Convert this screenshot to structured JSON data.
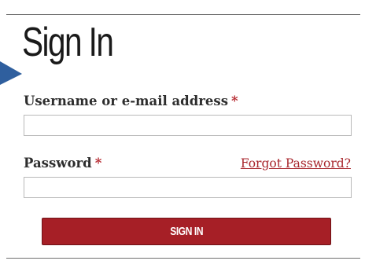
{
  "form": {
    "title": "Sign In",
    "username": {
      "label": "Username or e-mail address",
      "required_marker": "*",
      "value": ""
    },
    "password": {
      "label": "Password",
      "required_marker": "*",
      "value": ""
    },
    "forgot_password_label": "Forgot Password?",
    "submit_label": "SIGN IN"
  },
  "colors": {
    "accent": "#a61f26",
    "required": "#b5262d",
    "corner_arrow": "#2f5f9e"
  },
  "icons": {
    "corner": "arrow-icon"
  }
}
